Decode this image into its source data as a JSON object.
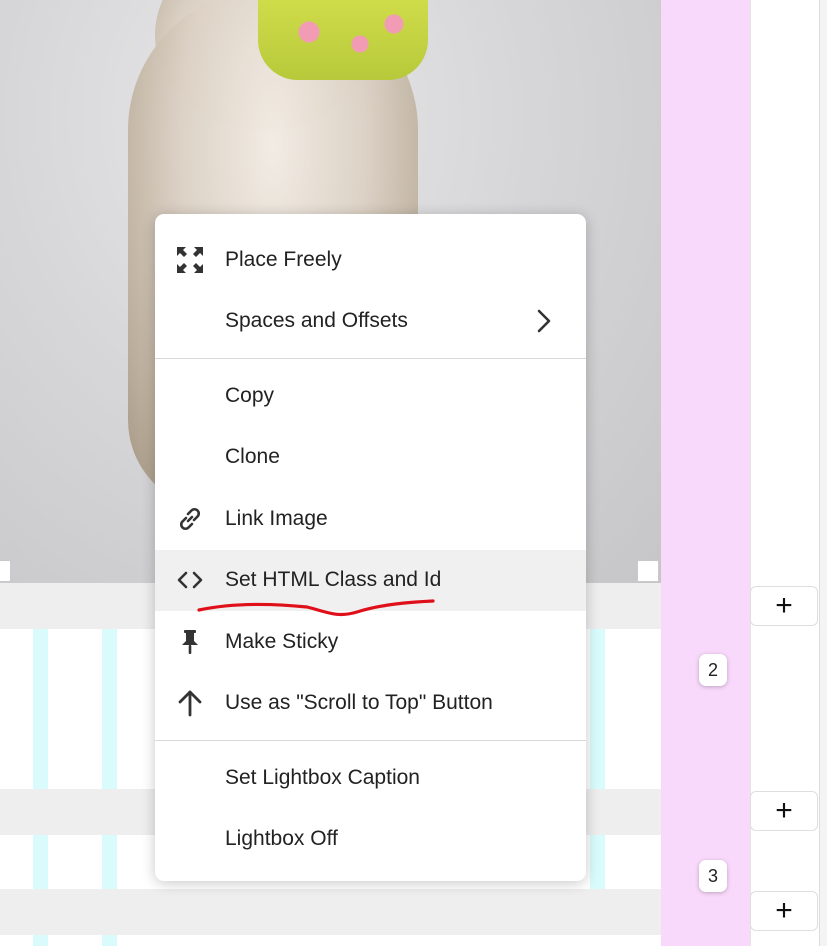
{
  "menu": {
    "groups": [
      [
        {
          "label": "Place Freely",
          "icon": "expand-arrows-icon"
        },
        {
          "label": "Spaces and Offsets",
          "icon": "",
          "submenu": true
        }
      ],
      [
        {
          "label": "Copy",
          "icon": ""
        },
        {
          "label": "Clone",
          "icon": ""
        },
        {
          "label": "Link Image",
          "icon": "link-icon"
        },
        {
          "label": "Set HTML Class and Id",
          "icon": "code-brackets-icon",
          "highlighted": true,
          "annotated_underline": true
        },
        {
          "label": "Make Sticky",
          "icon": "pin-icon"
        },
        {
          "label": "Use as \"Scroll to Top\" Button",
          "icon": "arrow-up-icon"
        }
      ],
      [
        {
          "label": "Set Lightbox Caption",
          "icon": ""
        },
        {
          "label": "Lightbox Off",
          "icon": ""
        }
      ]
    ]
  },
  "canvas": {
    "row_badges": [
      "2",
      "3"
    ],
    "add_button_label": "+"
  },
  "colors": {
    "pink_column": "#f9d9fb",
    "cyan_stripe": "#d9fbfc",
    "highlight_row": "#f0f0f0",
    "annotation_red": "#e0101a"
  }
}
